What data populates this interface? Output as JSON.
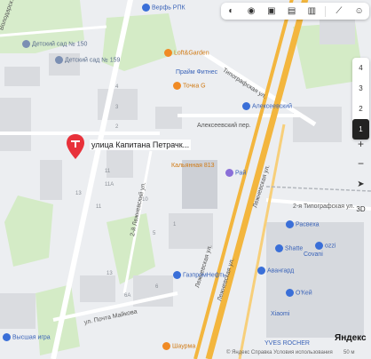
{
  "streets": {
    "kapitana_petrachkova": "улица Капитана Петрачк...",
    "tipografskaya": "Типографская ул.",
    "alekseevsky_per": "Алексеевский пер.",
    "lezhnevskaya_1": "Лежневская ул.",
    "lezhnevskaya_2": "Лежневская ул.",
    "lezhnevskaya_3": "Лежневская ул.",
    "tipografskaya_2": "2-я Типографская ул.",
    "lezhnevsky_2": "2-й Лежневский ул.",
    "pochta_maykova": "ул. Почта Майкова",
    "volodarskogo": "Володарск."
  },
  "pois": {
    "detsad_150": "Детский сад № 150",
    "detsad_159": "Детский сад № 159",
    "verfa_rpk": "Верфь РПК",
    "loft": "Loft&Garden",
    "prime": "Прайм Фитнес",
    "tochka": "Точка G",
    "alekseevsky": "Алексеевский",
    "kalyannaya": "Кальянная 813",
    "rai": "Рай",
    "gazprom": "ГазпромНефть",
    "raseka": "Расвеха",
    "shatte": "Shatte",
    "covani": "Covani",
    "ozzi": "ozzi",
    "avangard": "Авангард",
    "okei": "О'Кей",
    "xiaomi": "Xiaomi",
    "vysshaya": "Высшая игра",
    "shaurma": "Шаурма",
    "yves": "YVES ROCHER"
  },
  "numbers": [
    "13",
    "11",
    "11А",
    "4",
    "3",
    "2",
    "1",
    "5",
    "10",
    "11",
    "13",
    "6",
    "8",
    "7",
    "6А",
    "5А"
  ],
  "toolbar": {
    "icons": [
      "layers-icon",
      "panorama-icon",
      "camera-icon",
      "transport-icon",
      "car-icon",
      "ruler-icon",
      "profile-icon"
    ]
  },
  "floors": [
    "4",
    "3",
    "2",
    "1"
  ],
  "active_floor": "1",
  "controls": {
    "zoom_in": "+",
    "zoom_out": "−",
    "mode_3d": "3D"
  },
  "footer": {
    "yandex": "Яндекс",
    "links": "© Яндекс   Справка   Условия использования",
    "scale": "50 м"
  },
  "colors": {
    "road_main": "#f5b941",
    "road_secondary": "#ffffff",
    "park": "#cfe9c0",
    "building": "#dfe1e4",
    "pin": "#e8313a",
    "metro": "#3a6fd8"
  }
}
